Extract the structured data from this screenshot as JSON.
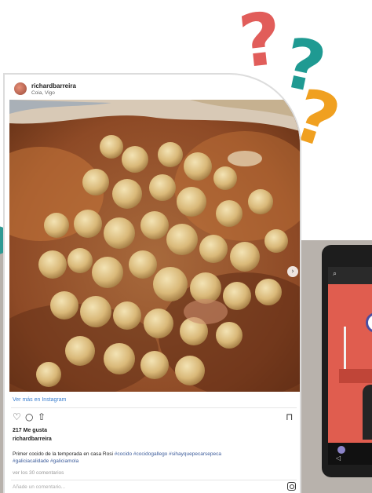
{
  "post": {
    "username": "richardbarreira",
    "location": "Coia, Vigo",
    "view_more": "Ver más en Instagram",
    "likes": "217 Me gusta",
    "caption_user": "richardbarreira",
    "caption_text": "Primer cocido de la temporada en casa Rosi",
    "caption_tags_inline": "#cocido #cocidogallego #sihayquepecarsepeca",
    "caption_tags_line2": "#galiciacalidade #galiciamola",
    "comments_link": "ver los 30 comentarios",
    "add_comment_placeholder": "Añade un comentario...",
    "carousel": {
      "count": 5,
      "active_index": 0
    }
  },
  "icons": {
    "like": "heart-icon",
    "comment": "comment-icon",
    "share": "share-icon",
    "save": "bookmark-icon",
    "instagram": "instagram-icon",
    "next": "chevron-right-icon"
  },
  "decor": {
    "question_marks": [
      {
        "glyph": "?",
        "color": "#e15d5a"
      },
      {
        "glyph": "?",
        "color": "#1f9a92"
      },
      {
        "glyph": "?",
        "color": "#f0a020"
      }
    ],
    "background_color": "#b8b2ac",
    "phone_screen_color": "#e05d4f"
  }
}
